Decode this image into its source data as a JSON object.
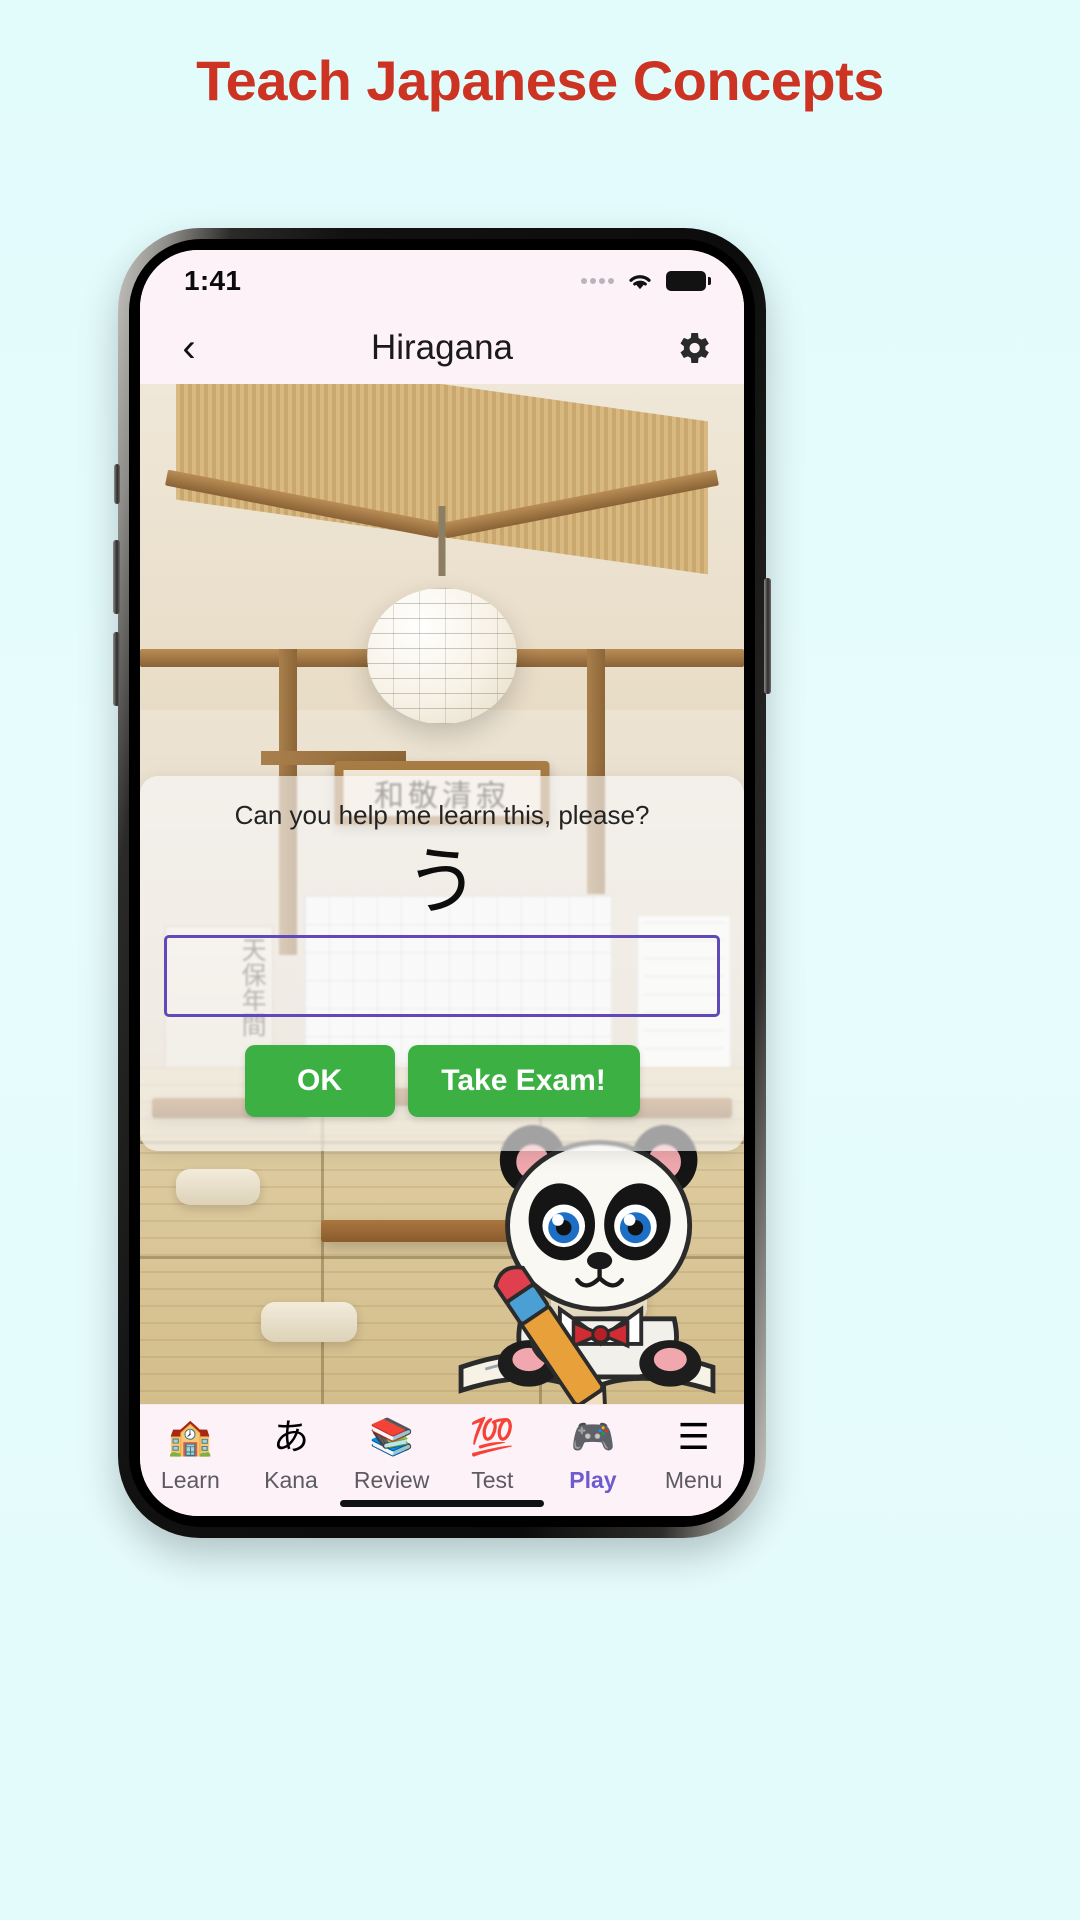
{
  "promo": {
    "headline": "Teach Japanese Concepts",
    "headline_color": "#cc3322",
    "background_color": "#e3fbfc"
  },
  "phone": {
    "status_bar": {
      "time": "1:41",
      "signal_icon": "signal-dots-icon",
      "wifi_icon": "wifi-icon",
      "battery_icon": "battery-full-icon"
    },
    "nav_bar": {
      "back_icon": "chevron-left-icon",
      "title": "Hiragana",
      "settings_icon": "gear-icon"
    }
  },
  "scene": {
    "plaque_text": "和敬清寂",
    "scroll_text": "天保年間",
    "description": "traditional-japanese-classroom"
  },
  "dialog": {
    "prompt": "Can you help me learn this, please?",
    "kana": "う",
    "input_value": "",
    "input_placeholder": "",
    "buttons": {
      "ok_label": "OK",
      "exam_label": "Take Exam!",
      "color": "#3cb043"
    }
  },
  "tab_bar": {
    "active_color": "#6f5bd0",
    "items": [
      {
        "label": "Learn",
        "icon": "🏫",
        "icon_name": "school-icon",
        "active": false
      },
      {
        "label": "Kana",
        "icon": "あ",
        "icon_name": "kana-icon",
        "active": false
      },
      {
        "label": "Review",
        "icon": "📚",
        "icon_name": "books-icon",
        "active": false
      },
      {
        "label": "Test",
        "icon": "💯",
        "icon_name": "hundred-icon",
        "active": false
      },
      {
        "label": "Play",
        "icon": "🎮",
        "icon_name": "gamepad-icon",
        "active": true
      },
      {
        "label": "Menu",
        "icon": "☰",
        "icon_name": "hamburger-icon",
        "active": false
      }
    ]
  }
}
